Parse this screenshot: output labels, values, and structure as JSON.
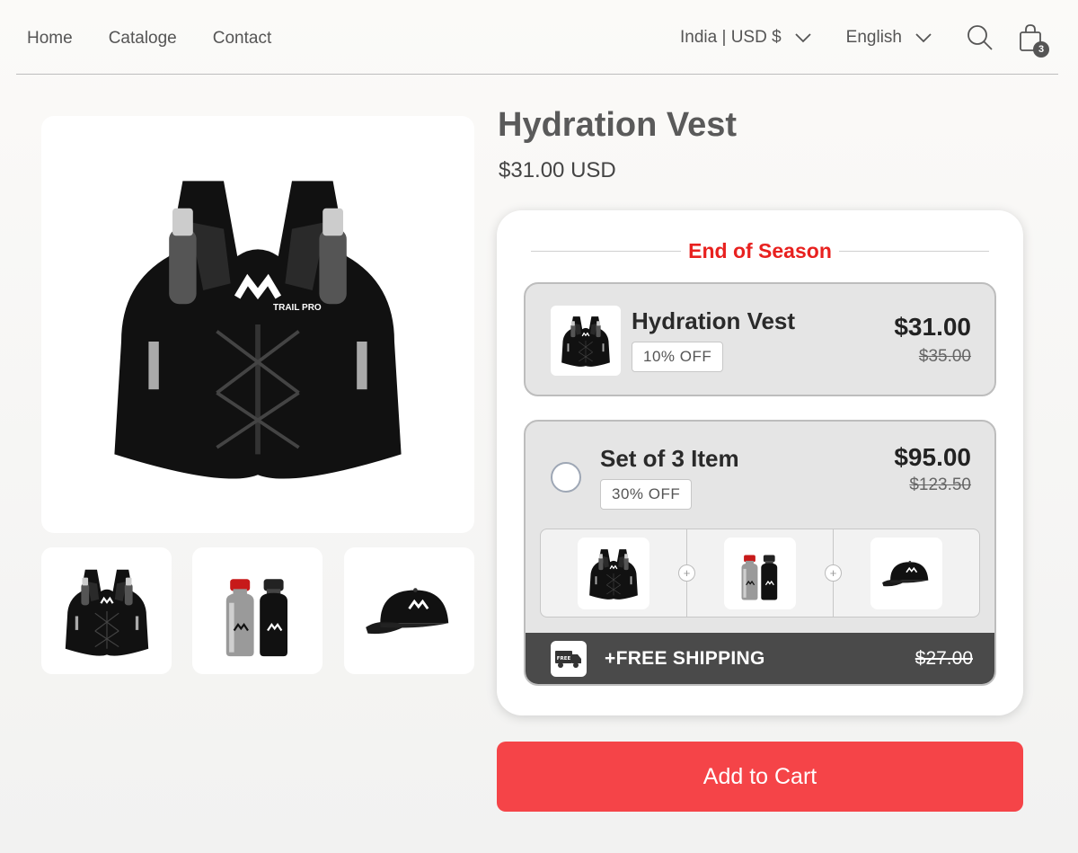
{
  "nav": {
    "links": [
      "Home",
      "Cataloge",
      "Contact"
    ],
    "country": "India | USD $",
    "language": "English",
    "cart_count": "3"
  },
  "product": {
    "title": "Hydration Vest",
    "price": "$31.00 USD",
    "vest_brand": "TRAIL PRO"
  },
  "bundle": {
    "banner": "End of Season",
    "options": [
      {
        "name": "Hydration Vest",
        "badge": "10% OFF",
        "price": "$31.00",
        "old_price": "$35.00"
      },
      {
        "name": "Set of 3 Item",
        "badge": "30% OFF",
        "price": "$95.00",
        "old_price": "$123.50"
      }
    ],
    "shipping_label": "+FREE SHIPPING",
    "shipping_old_price": "$27.00",
    "shipping_icon_text": "FREE"
  },
  "cta": {
    "add_to_cart": "Add to Cart"
  },
  "colors": {
    "accent": "#f54448",
    "banner": "#e8211f",
    "ship_bar": "#4a4a4a"
  }
}
